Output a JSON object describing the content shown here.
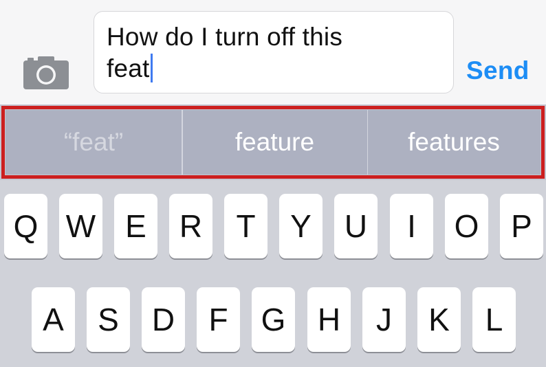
{
  "compose": {
    "camera_icon": "camera-icon",
    "message_line1": "How do I turn off this",
    "message_line2": "feat",
    "send_label": "Send"
  },
  "suggestions": [
    {
      "label": "“feat”",
      "kind": "typed"
    },
    {
      "label": "feature",
      "kind": "suggestion"
    },
    {
      "label": "features",
      "kind": "suggestion"
    }
  ],
  "keyboard": {
    "row1": [
      "Q",
      "W",
      "E",
      "R",
      "T",
      "Y",
      "U",
      "I",
      "O",
      "P"
    ],
    "row2": [
      "A",
      "S",
      "D",
      "F",
      "G",
      "H",
      "J",
      "K",
      "L"
    ]
  },
  "colors": {
    "send": "#1d8df5",
    "caret": "#3f7af0",
    "highlight": "#cc1f1f",
    "suggestion_bg": "#adb1c1",
    "keyboard_bg": "#d0d2d9"
  }
}
